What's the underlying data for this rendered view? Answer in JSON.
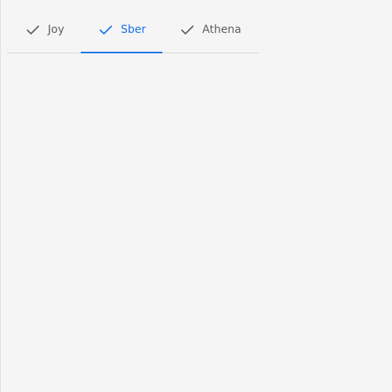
{
  "tabs": [
    {
      "label": "Joy",
      "icon": "check-icon",
      "active": false
    },
    {
      "label": "Sber",
      "icon": "check-icon",
      "active": true
    },
    {
      "label": "Athena",
      "icon": "check-icon",
      "active": false
    }
  ],
  "colors": {
    "accent": "#1a73e8",
    "inactive_text": "#5f5f5f",
    "background": "#f5f5f5",
    "divider": "#d6d6d6"
  }
}
